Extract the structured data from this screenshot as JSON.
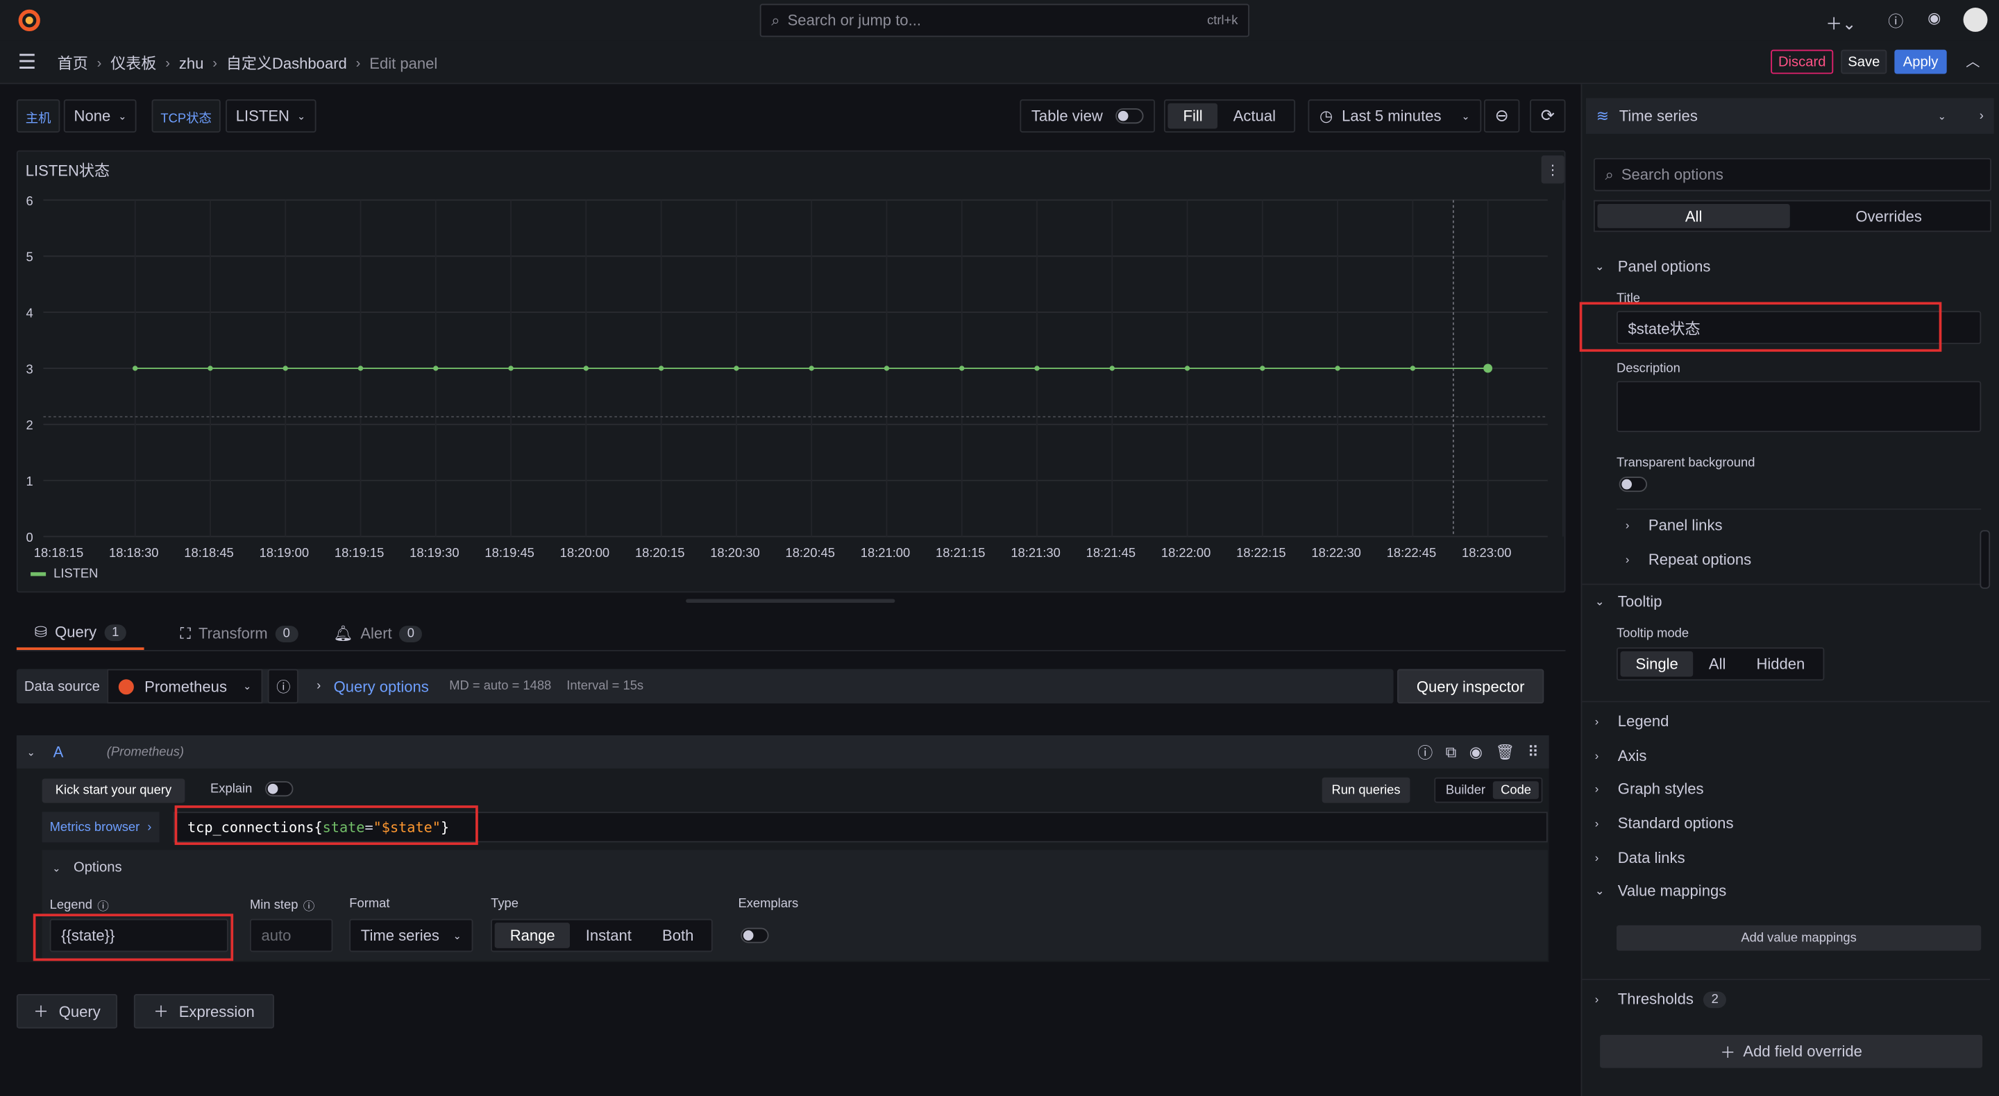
{
  "topbar": {
    "search_placeholder": "Search or jump to...",
    "shortcut": "ctrl+k"
  },
  "breadcrumb": [
    "首页",
    "仪表板",
    "zhu",
    "自定义Dashboard",
    "Edit panel"
  ],
  "actions": {
    "discard": "Discard",
    "save": "Save",
    "apply": "Apply"
  },
  "variables": [
    {
      "label": "主机",
      "value": "None"
    },
    {
      "label": "TCP状态",
      "value": "LISTEN"
    }
  ],
  "toolbar": {
    "table_view": "Table view",
    "fill": "Fill",
    "actual": "Actual",
    "time_range": "Last 5 minutes"
  },
  "panel": {
    "title": "LISTEN状态",
    "legend": "LISTEN"
  },
  "chart_data": {
    "type": "line",
    "x": [
      "18:18:15",
      "18:18:30",
      "18:18:45",
      "18:19:00",
      "18:19:15",
      "18:19:30",
      "18:19:45",
      "18:20:00",
      "18:20:15",
      "18:20:30",
      "18:20:45",
      "18:21:00",
      "18:21:15",
      "18:21:30",
      "18:21:45",
      "18:22:00",
      "18:22:15",
      "18:22:30",
      "18:22:45",
      "18:23:00"
    ],
    "y_ticks": [
      "0",
      "1",
      "2",
      "3",
      "4",
      "5",
      "6"
    ],
    "ylim": [
      0,
      6
    ],
    "series": [
      {
        "name": "LISTEN",
        "color": "#73bf69",
        "values": [
          3,
          3,
          3,
          3,
          3,
          3,
          3,
          3,
          3,
          3,
          3,
          3,
          3,
          3,
          3,
          3,
          3,
          3,
          3
        ]
      }
    ],
    "grid": true,
    "legend_position": "bottom-left"
  },
  "tabs": [
    {
      "label": "Query",
      "count": "1"
    },
    {
      "label": "Transform",
      "count": "0"
    },
    {
      "label": "Alert",
      "count": "0"
    }
  ],
  "datasource": {
    "label": "Data source",
    "value": "Prometheus",
    "query_options": "Query options",
    "md": "MD = auto = 1488",
    "interval": "Interval = 15s",
    "inspector": "Query inspector"
  },
  "query": {
    "ref": "A",
    "ds": "(Prometheus)",
    "kick": "Kick start your query",
    "explain": "Explain",
    "run": "Run queries",
    "builder": "Builder",
    "code": "Code",
    "metrics_browser": "Metrics browser",
    "expr_metric": "tcp_connections",
    "expr_open": "{",
    "expr_key": "state",
    "expr_eq": "=",
    "expr_val": "\"$state\"",
    "expr_close": "}",
    "options": "Options",
    "legend_label": "Legend",
    "legend_value": "{{state}}",
    "minstep_label": "Min step",
    "minstep_placeholder": "auto",
    "format_label": "Format",
    "format_value": "Time series",
    "type_label": "Type",
    "type_range": "Range",
    "type_instant": "Instant",
    "type_both": "Both",
    "exemplars": "Exemplars"
  },
  "add": {
    "query": "Query",
    "expression": "Expression"
  },
  "sidebar": {
    "viz": "Time series",
    "search_placeholder": "Search options",
    "all": "All",
    "overrides": "Overrides",
    "panel_options": "Panel options",
    "title_label": "Title",
    "title_value": "$state状态",
    "description": "Description",
    "transparent": "Transparent background",
    "panel_links": "Panel links",
    "repeat_options": "Repeat options",
    "tooltip": "Tooltip",
    "tooltip_mode": "Tooltip mode",
    "single": "Single",
    "all_mode": "All",
    "hidden": "Hidden",
    "legend": "Legend",
    "axis": "Axis",
    "graph_styles": "Graph styles",
    "standard_options": "Standard options",
    "data_links": "Data links",
    "value_mappings": "Value mappings",
    "add_value_mappings": "Add value mappings",
    "thresholds": "Thresholds",
    "thresholds_count": "2",
    "add_field_override": "Add field override"
  },
  "colors": {
    "accent": "#3d71d9",
    "series": "#73bf69",
    "highlight": "#e02f2f",
    "discard": "#e0226e"
  }
}
